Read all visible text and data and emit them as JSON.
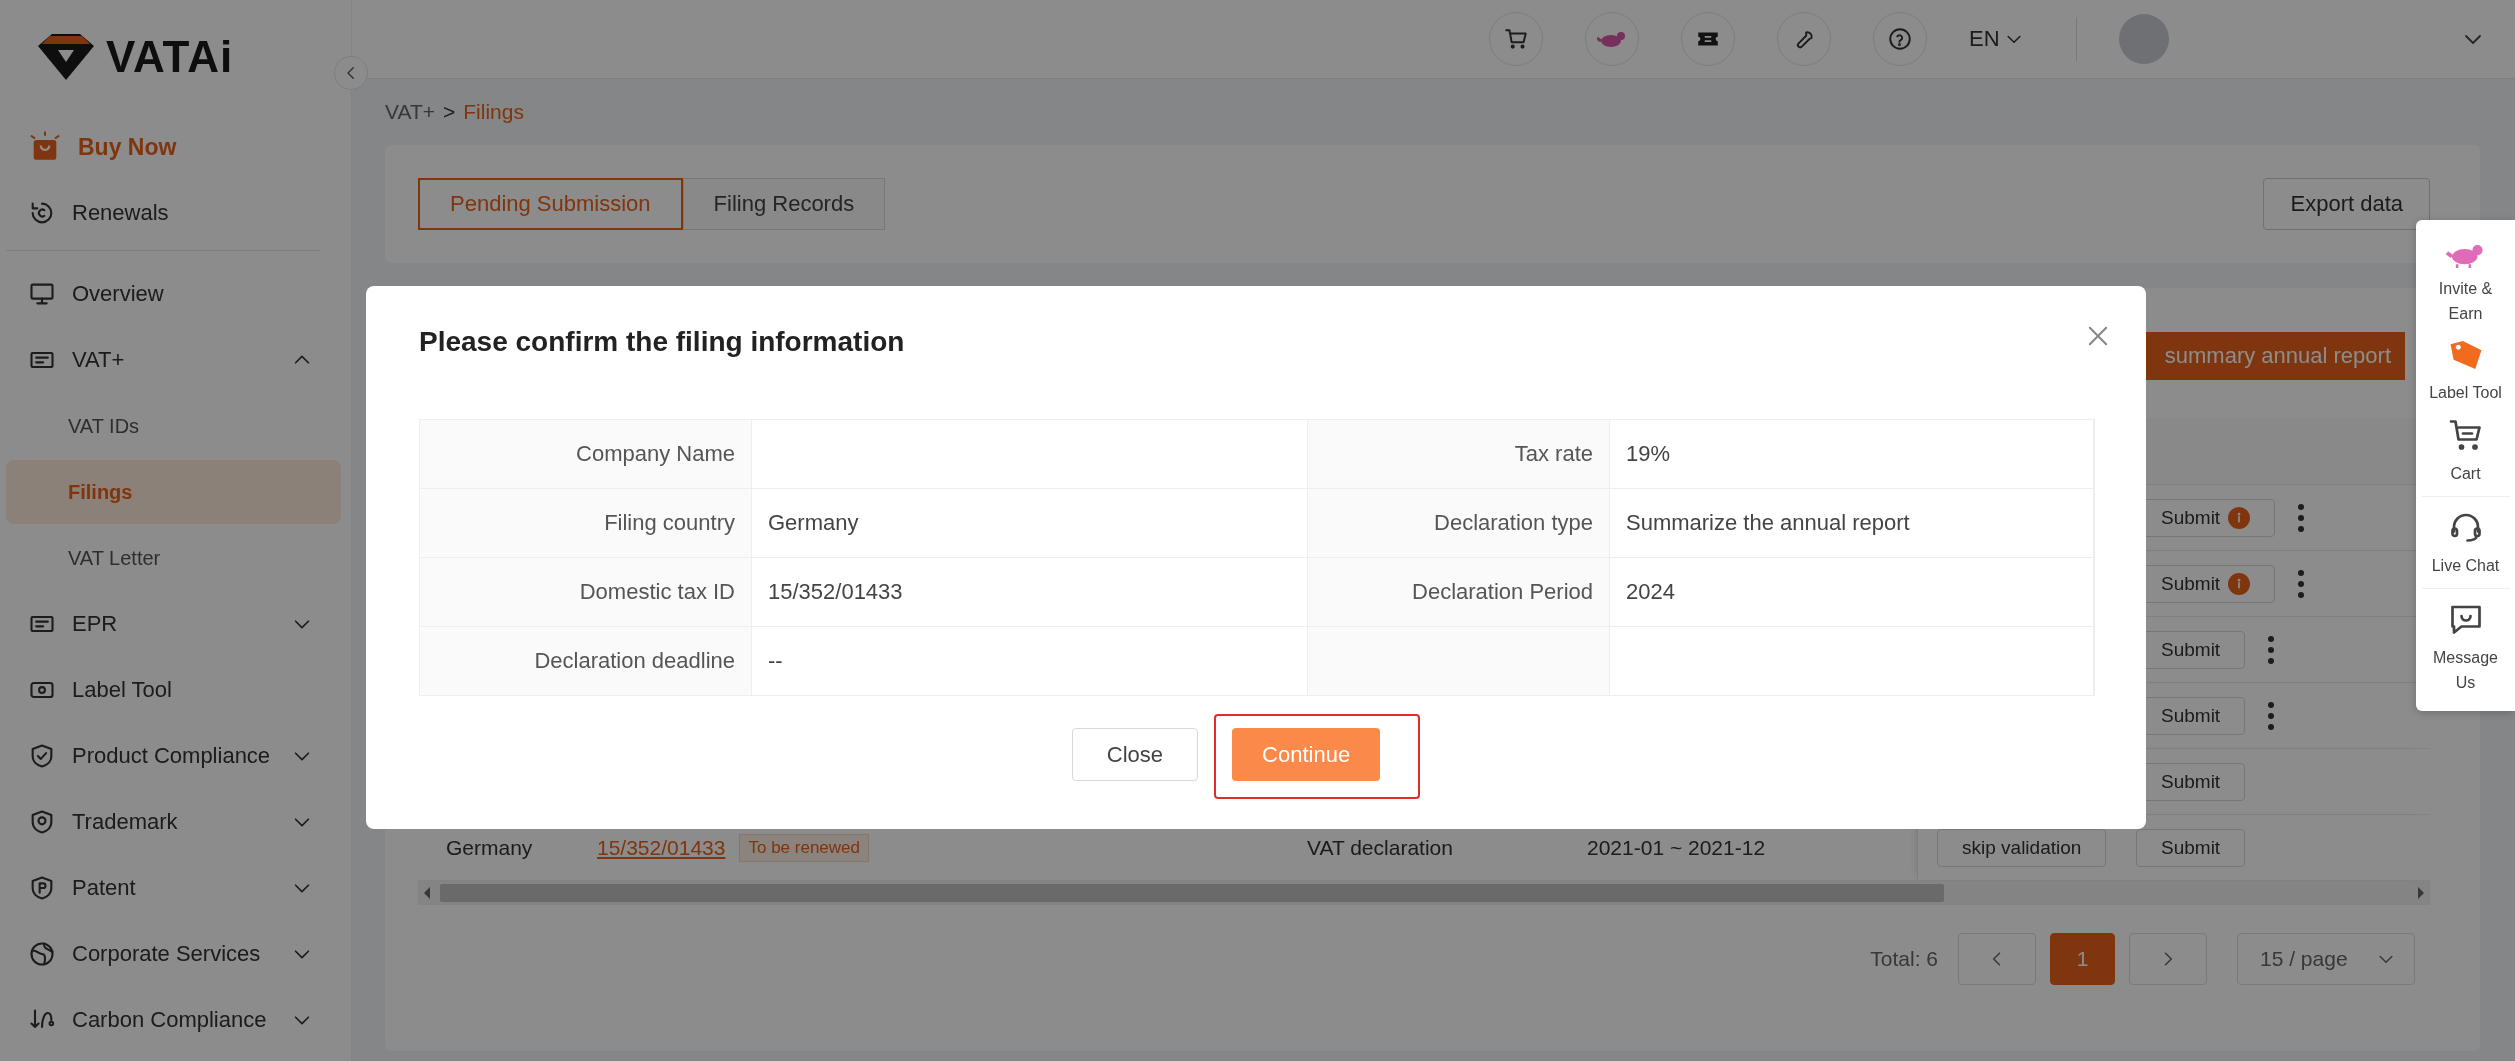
{
  "sidebar": {
    "logo": "VATAi",
    "top_items": [
      {
        "label": "Buy Now",
        "kind": "promo",
        "selected": false
      },
      {
        "label": "Renewals",
        "kind": "link",
        "selected": false
      }
    ],
    "items": [
      {
        "label": "Overview",
        "kind": "link",
        "selected": false
      },
      {
        "label": "VAT+",
        "kind": "group",
        "expanded": true,
        "selected": false,
        "children": [
          {
            "label": "VAT IDs",
            "selected": false
          },
          {
            "label": "Filings",
            "selected": true
          },
          {
            "label": "VAT Letter",
            "selected": false
          }
        ]
      },
      {
        "label": "EPR",
        "kind": "group",
        "expanded": false,
        "selected": false
      },
      {
        "label": "Label Tool",
        "kind": "link",
        "selected": false
      },
      {
        "label": "Product Compliance",
        "kind": "group",
        "expanded": false,
        "selected": false
      },
      {
        "label": "Trademark",
        "kind": "group",
        "expanded": false,
        "selected": false
      },
      {
        "label": "Patent",
        "kind": "group",
        "expanded": false,
        "selected": false
      },
      {
        "label": "Corporate Services",
        "kind": "group",
        "expanded": false,
        "selected": false
      },
      {
        "label": "Carbon Compliance",
        "kind": "group",
        "expanded": false,
        "selected": false
      }
    ]
  },
  "topbar": {
    "language": "EN"
  },
  "breadcrumb": {
    "items": [
      "VAT+",
      "Filings"
    ],
    "separator": ">"
  },
  "tabs": [
    {
      "label": "Pending Submission",
      "selected": true
    },
    {
      "label": "Filing Records",
      "selected": false
    }
  ],
  "export_button": "Export data",
  "report_button": "summary annual report",
  "table": {
    "rows": [
      {
        "actions": [
          {
            "label": "Submit",
            "kind": "submit",
            "warning": true
          }
        ],
        "more_menu": true
      },
      {
        "actions": [
          {
            "label": "Submit",
            "kind": "submit",
            "warning": true
          }
        ],
        "more_menu": true
      },
      {
        "actions": [
          {
            "label": "Submit",
            "kind": "submit",
            "warning": false
          }
        ],
        "more_menu": true
      },
      {
        "actions": [
          {
            "label": "Submit",
            "kind": "submit",
            "warning": false
          }
        ],
        "more_menu": true
      },
      {
        "actions": [
          {
            "label": "Submit",
            "kind": "submit",
            "warning": false
          }
        ],
        "more_menu": false
      },
      {
        "country": "Germany",
        "tax_id": "15/352/01433",
        "tag": "To be renewed",
        "type": "VAT declaration",
        "period": "2021-01 ~ 2021-12",
        "actions": [
          {
            "label": "skip validation",
            "kind": "skip"
          },
          {
            "label": "Submit",
            "kind": "submit",
            "warning": false
          }
        ],
        "more_menu": false
      }
    ]
  },
  "pagination": {
    "total": "Total: 6",
    "pages": [
      {
        "label": "1",
        "selected": true
      }
    ],
    "page_size": "15 / page"
  },
  "float_panel": {
    "items": [
      {
        "label": "Invite & Earn"
      },
      {
        "label": "Label Tool"
      },
      {
        "label": "Cart"
      },
      {
        "label": "Live Chat"
      },
      {
        "label": "Message Us"
      }
    ]
  },
  "modal": {
    "title": "Please confirm the filing information",
    "rows": [
      [
        {
          "label": "Company Name"
        },
        {
          "label": "Tax rate",
          "value": "19%"
        }
      ],
      [
        {
          "label": "Filing country",
          "value": "Germany"
        },
        {
          "label": "Declaration type",
          "value": "Summarize the annual report"
        }
      ],
      [
        {
          "label": "Domestic tax ID",
          "value": "15/352/01433"
        },
        {
          "label": "Declaration Period",
          "value": "2024"
        }
      ],
      [
        {
          "label": "Declaration deadline",
          "value": "--"
        },
        {}
      ]
    ],
    "buttons": [
      {
        "label": "Close",
        "kind": "secondary",
        "highlighted": false
      },
      {
        "label": "Continue",
        "kind": "primary",
        "highlighted": true
      }
    ]
  }
}
